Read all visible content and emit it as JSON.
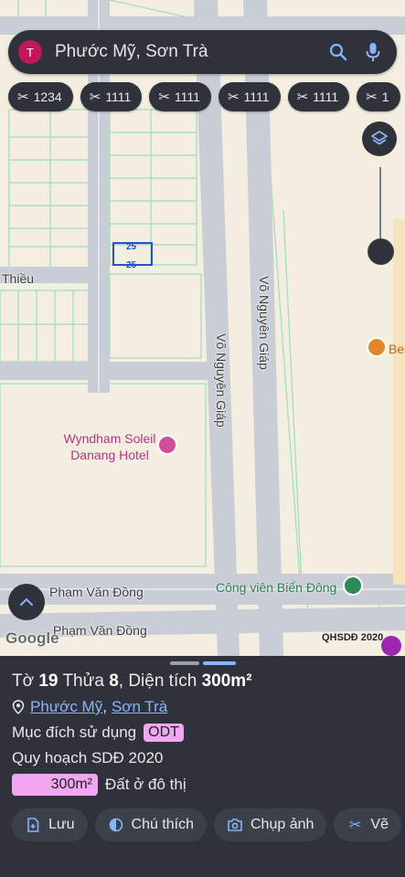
{
  "search": {
    "avatar_letter": "T",
    "query": "Phước Mỹ, Sơn Trà"
  },
  "chips": [
    {
      "label": "1234",
      "icon": "ruler-icon"
    },
    {
      "label": "1111",
      "icon": "ruler-icon"
    },
    {
      "label": "1111",
      "icon": "ruler-icon"
    },
    {
      "label": "1111",
      "icon": "ruler-icon"
    },
    {
      "label": "1111",
      "icon": "ruler-icon"
    },
    {
      "label": "1",
      "icon": "ruler-icon"
    }
  ],
  "map": {
    "street_thieu": "Thiều",
    "street_vo_nguyen_giap": "Võ Nguyên Giáp",
    "street_pham_van_dong": "Phạm Văn Đồng",
    "hotel_name": "Wyndham Soleil Danang Hotel",
    "park_name": "Công viên Biển Đông",
    "cafe_name": "Be",
    "plot_number_a": "25",
    "plot_number_b": "25",
    "google_logo": "Google",
    "overlay_label": "QHSDĐ 2020"
  },
  "sheet": {
    "to_label": "Tờ",
    "to_value": "19",
    "thua_label": "Thửa",
    "thua_value": "8",
    "dien_tich_label": "Diện tích",
    "dien_tich_value": "300m²",
    "ward": "Phước Mỹ",
    "district": "Sơn Trà",
    "purpose_label": "Mục đích sử dụng",
    "purpose_code": "ODT",
    "plan_label": "Quy hoạch SDĐ 2020",
    "area_box": "300m²",
    "area_text": "Đất ở đô thị"
  },
  "actions": [
    {
      "label": "Lưu",
      "icon": "save-icon"
    },
    {
      "label": "Chú thích",
      "icon": "legend-icon"
    },
    {
      "label": "Chụp ảnh",
      "icon": "camera-icon"
    },
    {
      "label": "Vẽ",
      "icon": "ruler-icon"
    }
  ],
  "colors": {
    "panel": "#2f323a",
    "accent": "#8ab4f8",
    "odt": "#f0a6f0",
    "map_bg": "#f3eedf"
  }
}
